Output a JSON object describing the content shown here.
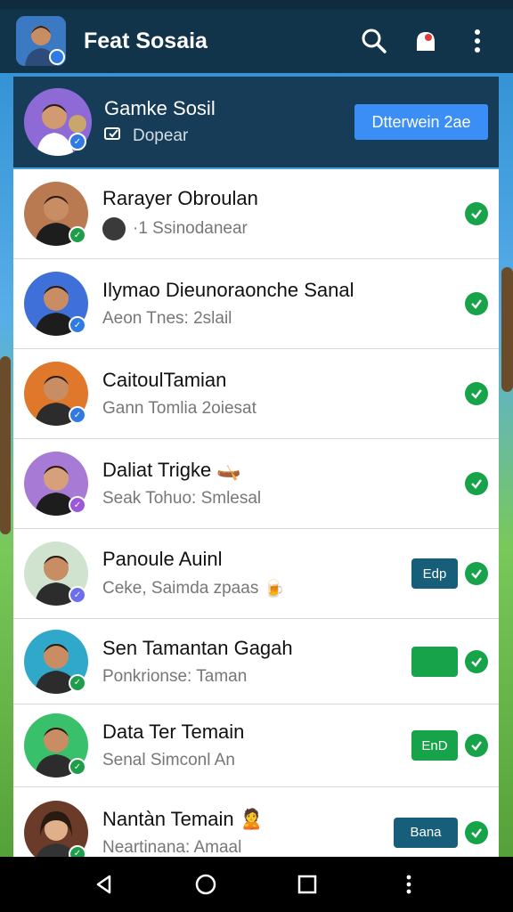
{
  "app": {
    "title": "Feat Sosaia"
  },
  "header": {
    "title": "Gamke Sosil",
    "subtitle": "Dopear",
    "cta": "Dtterwein 2ae"
  },
  "contacts": [
    {
      "name": "Rarayer Obroulan",
      "status": "·1 Ssinodanear",
      "tag": "",
      "tag_color": "",
      "badge_color": "#1e9e4a",
      "emoji": ""
    },
    {
      "name": "Ilymao Dieunoraonche Sanal",
      "status": "Aeon Tnes: 2slail",
      "tag": "",
      "tag_color": "",
      "badge_color": "#2f7ae5",
      "emoji": ""
    },
    {
      "name": "CaitoulTamian",
      "status": "Gann Tomlia 2oiesat",
      "tag": "",
      "tag_color": "",
      "badge_color": "#2f7ae5",
      "emoji": ""
    },
    {
      "name": "Daliat Trigke",
      "status": "Seak Tohuo: Smlesal",
      "tag": "",
      "tag_color": "",
      "badge_color": "#9b59d9",
      "emoji": "🛶"
    },
    {
      "name": "Panoule Auinl",
      "status": "Ceke, Saimda zpaas",
      "tag": "Edp",
      "tag_color": "#175e7a",
      "badge_color": "#6c6ef0",
      "emoji": "🍺"
    },
    {
      "name": "Sen Tamantan Gagah",
      "status": "Ponkrionse: Taman",
      "tag": "",
      "tag_color": "#16a34a",
      "badge_color": "#1e9e4a",
      "emoji": ""
    },
    {
      "name": "Data Ter Temain",
      "status": "Senal Simconl An",
      "tag": "EnD",
      "tag_color": "#16a34a",
      "badge_color": "#1e9e4a",
      "emoji": ""
    },
    {
      "name": "Nantàn Temain",
      "status": "Neartinana: Amaal",
      "tag": "Bana",
      "tag_color": "#175e7a",
      "badge_color": "#1e9e4a",
      "emoji": "🙎"
    }
  ],
  "icons": {
    "search": "search-icon",
    "notify": "bell-icon",
    "more": "more-vert-icon",
    "back": "back-icon",
    "home": "home-icon",
    "recents": "recents-icon"
  }
}
